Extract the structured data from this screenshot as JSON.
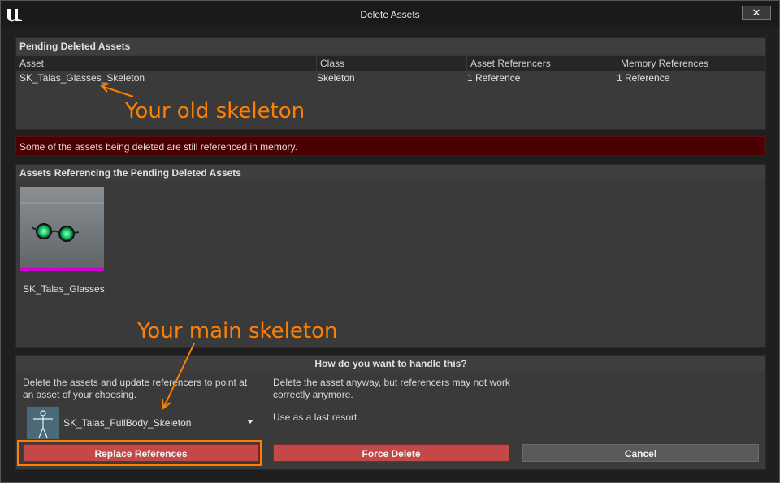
{
  "window": {
    "title": "Delete Assets",
    "close_label": "✕"
  },
  "pending": {
    "header": "Pending Deleted Assets",
    "columns": [
      "Asset",
      "Class",
      "Asset Referencers",
      "Memory References"
    ],
    "rows": [
      {
        "asset": "SK_Talas_Glasses_Skeleton",
        "class": "Skeleton",
        "asset_refs": "1 Reference",
        "memory_refs": "1 Reference"
      }
    ]
  },
  "warning": "Some of the assets being deleted are still referenced in memory.",
  "referencing": {
    "header": "Assets Referencing the Pending Deleted Assets",
    "items": [
      {
        "name": "SK_Talas_Glasses"
      }
    ]
  },
  "annotations": {
    "old": "Your old skeleton",
    "main": "Your main skeleton",
    "color": "#ff8000"
  },
  "handle": {
    "header": "How do you want to handle this?",
    "replace_desc": "Delete the assets and update referencers to point at an asset of your choosing.",
    "selected_asset": "SK_Talas_FullBody_Skeleton",
    "force_desc": "Delete the asset anyway, but referencers may not work correctly anymore.",
    "force_note": "Use as a last resort.",
    "replace_label": "Replace References",
    "force_label": "Force Delete",
    "cancel_label": "Cancel"
  },
  "colors": {
    "danger": "#c44848",
    "warning_bg": "#4a0000",
    "highlight": "#ff8000"
  }
}
